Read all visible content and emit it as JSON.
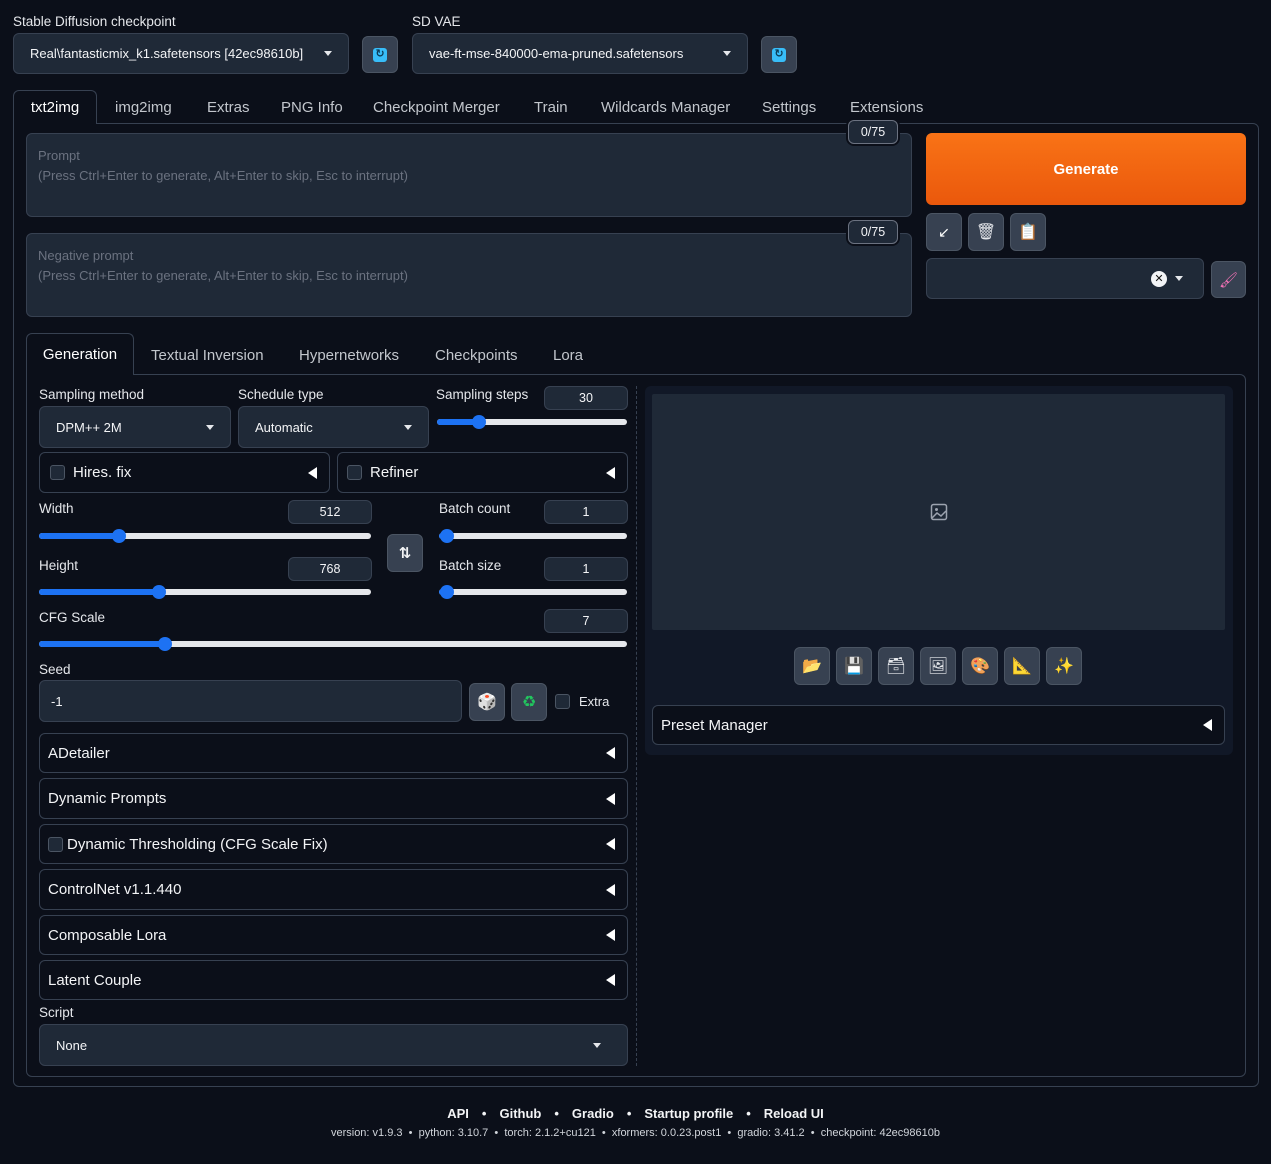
{
  "header": {
    "checkpoint_label": "Stable Diffusion checkpoint",
    "checkpoint_value": "Real\\fantasticmix_k1.safetensors [42ec98610b]",
    "vae_label": "SD VAE",
    "vae_value": "vae-ft-mse-840000-ema-pruned.safetensors"
  },
  "tabs": [
    "txt2img",
    "img2img",
    "Extras",
    "PNG Info",
    "Checkpoint Merger",
    "Train",
    "Wildcards Manager",
    "Settings",
    "Extensions"
  ],
  "prompt": {
    "counter": "0/75",
    "title": "Prompt",
    "hint": "(Press Ctrl+Enter to generate, Alt+Enter to skip, Esc to interrupt)"
  },
  "negative_prompt": {
    "counter": "0/75",
    "title": "Negative prompt",
    "hint": "(Press Ctrl+Enter to generate, Alt+Enter to skip, Esc to interrupt)"
  },
  "generate_label": "Generate",
  "subtabs": [
    "Generation",
    "Textual Inversion",
    "Hypernetworks",
    "Checkpoints",
    "Lora"
  ],
  "generation": {
    "sampling_method_label": "Sampling method",
    "sampling_method_value": "DPM++ 2M",
    "schedule_type_label": "Schedule type",
    "schedule_type_value": "Automatic",
    "sampling_steps_label": "Sampling steps",
    "sampling_steps_value": "30",
    "hires_label": "Hires. fix",
    "refiner_label": "Refiner",
    "width_label": "Width",
    "width_value": "512",
    "height_label": "Height",
    "height_value": "768",
    "batch_count_label": "Batch count",
    "batch_count_value": "1",
    "batch_size_label": "Batch size",
    "batch_size_value": "1",
    "cfg_label": "CFG Scale",
    "cfg_value": "7",
    "seed_label": "Seed",
    "seed_value": "-1",
    "extra_label": "Extra",
    "script_label": "Script",
    "script_value": "None"
  },
  "accordions": [
    "ADetailer",
    "Dynamic Prompts",
    "Dynamic Thresholding (CFG Scale Fix)",
    "ControlNet v1.1.440",
    "Composable Lora",
    "Latent Couple"
  ],
  "preset_manager_label": "Preset Manager",
  "footer": {
    "links": [
      "API",
      "Github",
      "Gradio",
      "Startup profile",
      "Reload UI"
    ],
    "version": "version: v1.9.3  •  python: 3.10.7  •  torch: 2.1.2+cu121  •  xformers: 0.0.23.post1  •  gradio: 3.41.2  •  checkpoint: 42ec98610b"
  },
  "colors": {
    "background": "#0b0f19",
    "generate": "#f97316",
    "slider": "#1d72f3"
  }
}
